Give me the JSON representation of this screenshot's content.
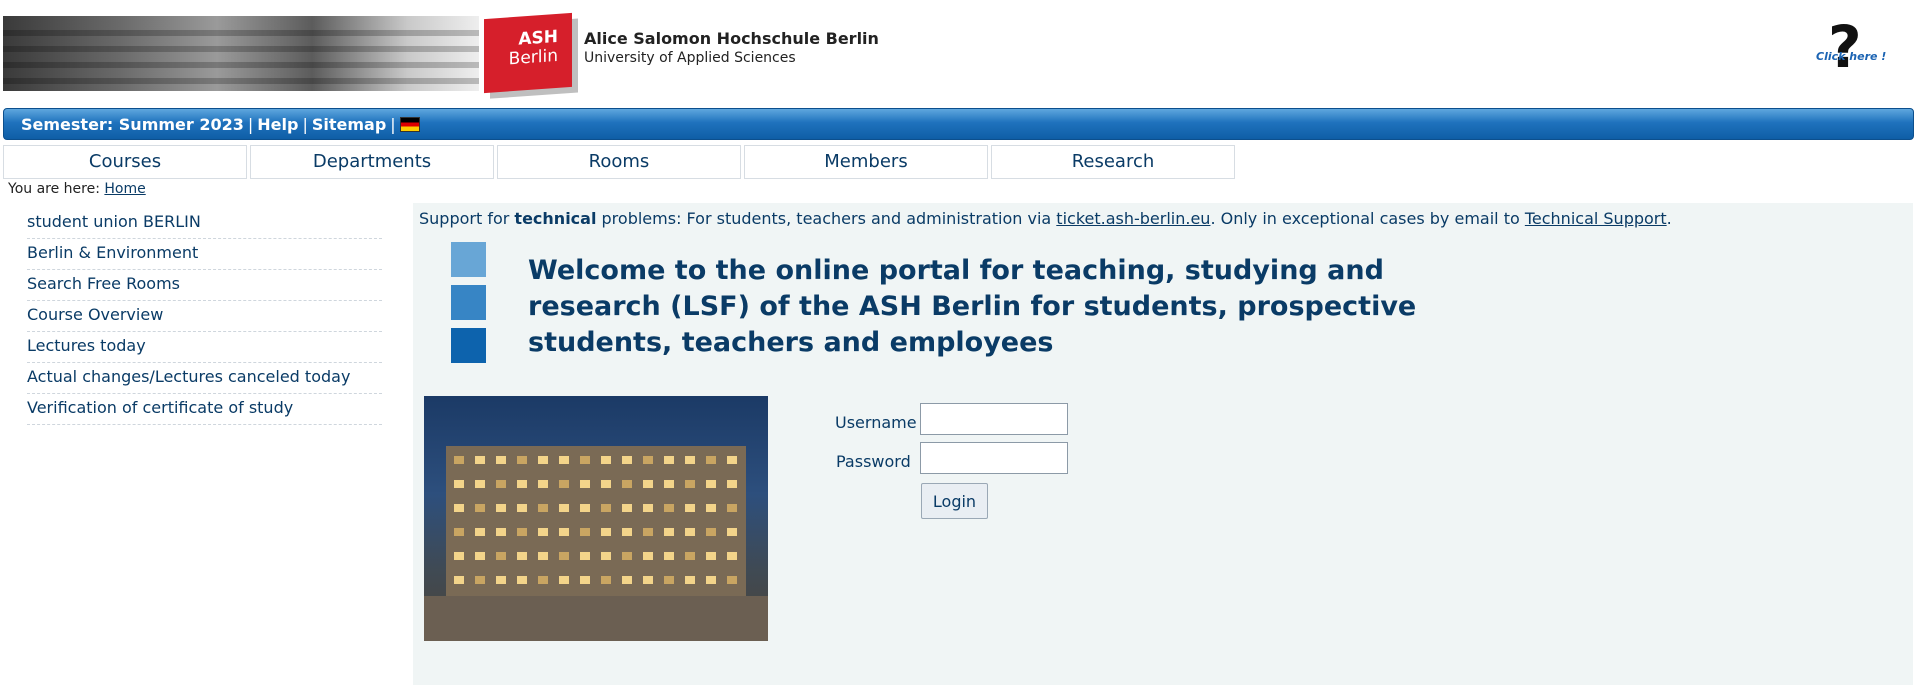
{
  "header": {
    "university_name": "Alice Salomon Hochschule Berlin",
    "university_subtitle": "University of Applied Sciences",
    "logo_line1": "ASH",
    "logo_line2": "Berlin",
    "help_text": "Click here !"
  },
  "topbar": {
    "semester": "Semester: Summer 2023",
    "help": "Help",
    "sitemap": "Sitemap",
    "separator": "|"
  },
  "tabs": [
    {
      "label": "Courses"
    },
    {
      "label": "Departments"
    },
    {
      "label": "Rooms"
    },
    {
      "label": "Members"
    },
    {
      "label": "Research"
    }
  ],
  "breadcrumb": {
    "prefix": "You are here:",
    "home": "Home"
  },
  "sidebar": {
    "items": [
      {
        "label": "student union BERLIN"
      },
      {
        "label": "Berlin & Environment"
      },
      {
        "label": "Search Free Rooms"
      },
      {
        "label": "Course Overview"
      },
      {
        "label": "Lectures today"
      },
      {
        "label": "Actual changes/Lectures canceled today"
      },
      {
        "label": "Verification of certificate of study"
      }
    ]
  },
  "main": {
    "support_prefix": "Support for ",
    "support_bold": "technical",
    "support_mid": " problems: For students, teachers and administration via ",
    "support_link1": "ticket.ash-berlin.eu",
    "support_mid2": ". Only in exceptional cases by email to ",
    "support_link2": "Technical Support",
    "support_suffix": ".",
    "welcome": "Welcome to the online portal for teaching, studying and research (LSF) of the ASH Berlin for students, prospective students, teachers and employees"
  },
  "login": {
    "username_label": "Username",
    "password_label": "Password",
    "username_value": "",
    "password_value": "",
    "button_label": "Login"
  },
  "colors": {
    "brand_red": "#d61f2b",
    "brand_blue": "#1f72bd",
    "text_navy": "#0a3b66"
  }
}
